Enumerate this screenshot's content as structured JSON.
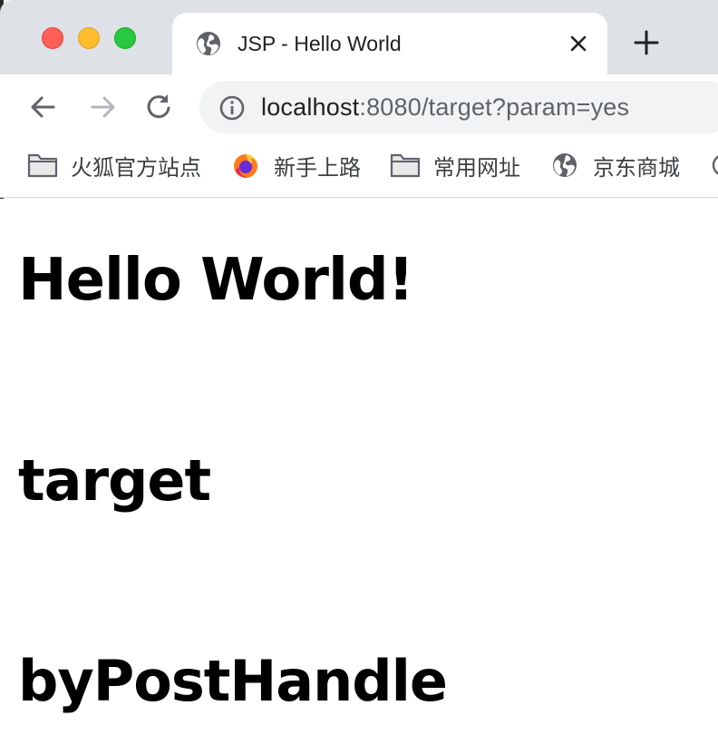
{
  "window": {
    "controls": [
      "close",
      "minimize",
      "zoom"
    ],
    "colors": {
      "close": "#fe5f57",
      "minimize": "#febc2e",
      "zoom": "#28c840"
    }
  },
  "tab": {
    "title": "JSP - Hello World",
    "favicon": "globe-icon",
    "close_icon": "close-icon"
  },
  "new_tab_icon": "plus-icon",
  "toolbar": {
    "back_icon": "arrow-left-icon",
    "forward_icon": "arrow-right-icon",
    "reload_icon": "reload-icon",
    "site_info_icon": "info-icon",
    "url_host": "localhost",
    "url_rest": ":8080/target?param=yes"
  },
  "bookmarks": [
    {
      "label": "火狐官方站点",
      "icon": "folder-icon"
    },
    {
      "label": "新手上路",
      "icon": "firefox-icon"
    },
    {
      "label": "常用网址",
      "icon": "folder-icon"
    },
    {
      "label": "京东商城",
      "icon": "globe-icon"
    }
  ],
  "page": {
    "heading": "Hello World!",
    "lines": [
      "target",
      "byPostHandle"
    ]
  }
}
